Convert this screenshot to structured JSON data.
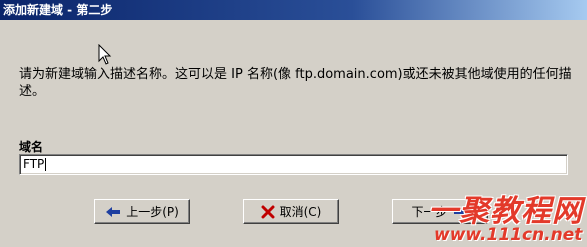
{
  "window": {
    "title": "添加新建域 - 第二步"
  },
  "instructions": "请为新建域输入描述名称。这可以是 IP 名称(像 ftp.domain.com)或还未被其他域使用的任何描述。",
  "domain_field": {
    "label": "域名",
    "value": "FTP"
  },
  "buttons": {
    "back": "上一步(P)",
    "cancel": "取消(C)",
    "next": "下一步"
  },
  "icons": {
    "back": "left-arrow-icon",
    "cancel": "red-x-icon",
    "next": "right-arrow-icon",
    "pointer": "mouse-cursor-icon"
  },
  "colors": {
    "titlebar": "#0a246a",
    "dialog_bg": "#d4d0c8",
    "back_arrow": "#1f3fa0",
    "cancel_x": "#c00000",
    "watermark": "#e3392a"
  },
  "watermark": {
    "main": "一聚教程网",
    "url": "www.111cn.net"
  }
}
